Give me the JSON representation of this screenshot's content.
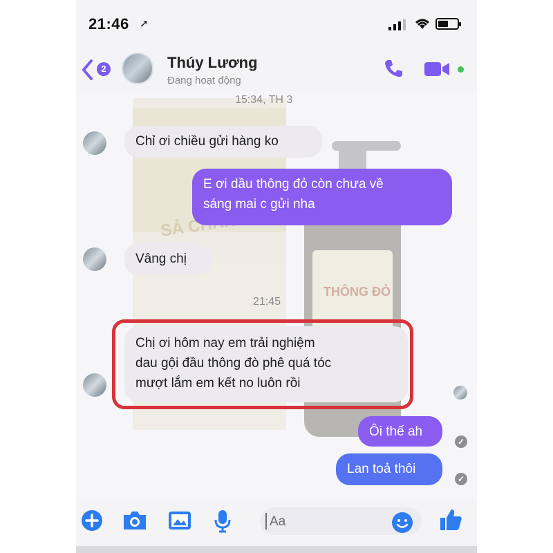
{
  "colors": {
    "accent": "#7b5bf0",
    "outgoing_bubble": "#8a5cf0",
    "outgoing_bubble_blue": "#5572f2",
    "incoming_bubble": "#eceaee",
    "highlight_box": "#d6333b",
    "online": "#43c05a"
  },
  "status_bar": {
    "time": "21:46",
    "location_icon": "location-arrow-icon",
    "signal_icon": "signal-icon",
    "wifi_icon": "wifi-icon",
    "battery_icon": "battery-icon"
  },
  "header": {
    "back_icon": "chevron-left-icon",
    "back_count": "2",
    "contact_name": "Thúy Lương",
    "contact_status": "Đang hoạt động",
    "call_icon": "phone-icon",
    "video_icon": "video-camera-icon"
  },
  "messages": {
    "stamp_1": "15:34, TH 3",
    "m1": "Chỉ ơi chiều gửi hàng ko",
    "m2_line1": "E ơi dầu thông đỏ còn chưa về",
    "m2_line2": "sáng mai c gửi nha",
    "m3": "Vâng chị",
    "stamp_2": "21:45",
    "m4_line1": "Chị ơi hôm nay em trải nghiệm",
    "m4_line2": "dau gội đầu thông đò phê quá tóc",
    "m4_line3": "mượt lắm em kết no luôn rồi",
    "m5": "Ôi thế ah",
    "m6": "Lan toả thôi"
  },
  "watermark": {
    "box_label": "SẢ CHANH",
    "bottle_label": "THÔNG ĐỎ"
  },
  "composer": {
    "placeholder": "Aa",
    "icons": [
      "plus-icon",
      "camera-icon",
      "image-icon",
      "microphone-icon",
      "emoji-icon",
      "thumbs-up-icon"
    ]
  }
}
